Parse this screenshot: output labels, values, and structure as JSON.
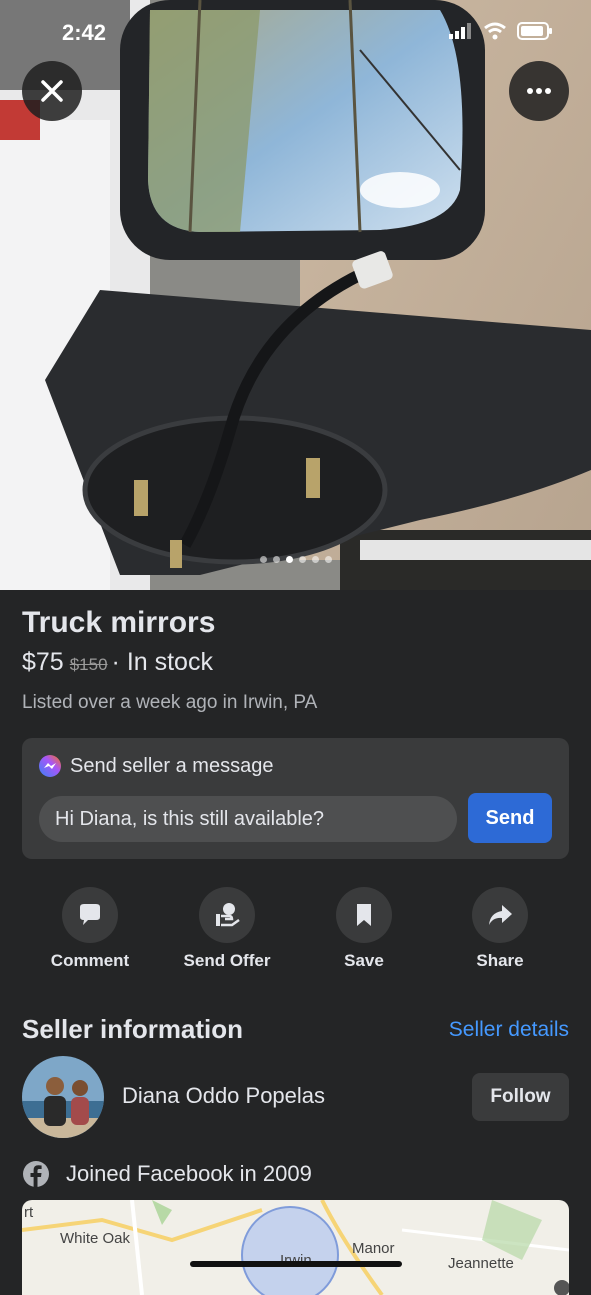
{
  "status": {
    "time": "2:42"
  },
  "photo": {
    "image_indicator_count": 6,
    "active_index": 2
  },
  "listing": {
    "title": "Truck mirrors",
    "price": "$75",
    "original_price": "$150",
    "availability": "· In stock",
    "listed": "Listed over a week ago in Irwin, PA"
  },
  "message": {
    "heading": "Send seller a message",
    "input_value": "Hi Diana, is this still available?",
    "send_label": "Send"
  },
  "actions": [
    {
      "label": "Comment",
      "icon": "comment-icon"
    },
    {
      "label": "Send Offer",
      "icon": "offer-icon"
    },
    {
      "label": "Save",
      "icon": "bookmark-icon"
    },
    {
      "label": "Share",
      "icon": "share-icon"
    }
  ],
  "seller": {
    "heading": "Seller information",
    "details_link": "Seller details",
    "name": "Diana Oddo Popelas",
    "follow_label": "Follow",
    "joined": "Joined Facebook in 2009"
  },
  "map": {
    "labels": [
      "rt",
      "White Oak",
      "Irwin",
      "Manor",
      "Jeannette"
    ]
  },
  "colors": {
    "accent": "#2d6ad6",
    "link": "#4599ff",
    "background": "#242526"
  }
}
